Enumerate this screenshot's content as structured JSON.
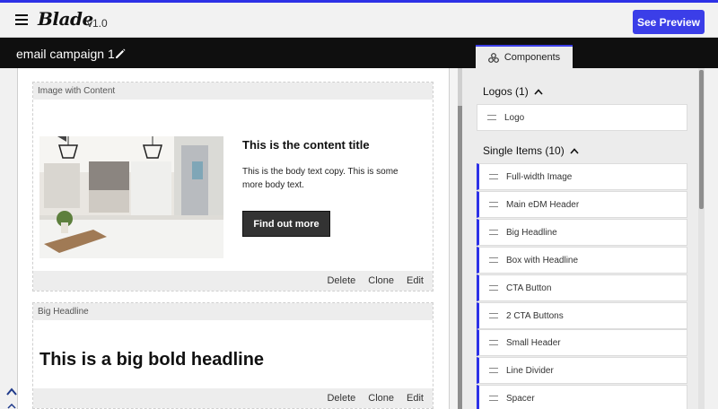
{
  "app": {
    "name": "Blade",
    "version": "v1.0",
    "preview_label": "See Preview"
  },
  "campaign": {
    "title": "email campaign 1"
  },
  "sidebar_tab": {
    "label": "Components"
  },
  "blocks": [
    {
      "label": "Image with Content",
      "content_title": "This is the content title",
      "body": "This is the body text copy. This is some more body text.",
      "cta": "Find out more",
      "actions": [
        "Delete",
        "Clone",
        "Edit"
      ]
    },
    {
      "label": "Big Headline",
      "headline": "This is a big bold headline",
      "actions": [
        "Delete",
        "Clone",
        "Edit"
      ]
    }
  ],
  "groups": [
    {
      "title": "Logos (1)",
      "items": [
        "Logo"
      ]
    },
    {
      "title": "Single Items (10)",
      "items": [
        "Full-width Image",
        "Main eDM Header",
        "Big Headline",
        "Box with Headline",
        "CTA Button",
        "2 CTA Buttons",
        "Small Header",
        "Line Divider",
        "Spacer"
      ]
    }
  ],
  "colors": {
    "accent": "#3b3ee8",
    "dark_bar": "#0f0f0f"
  }
}
